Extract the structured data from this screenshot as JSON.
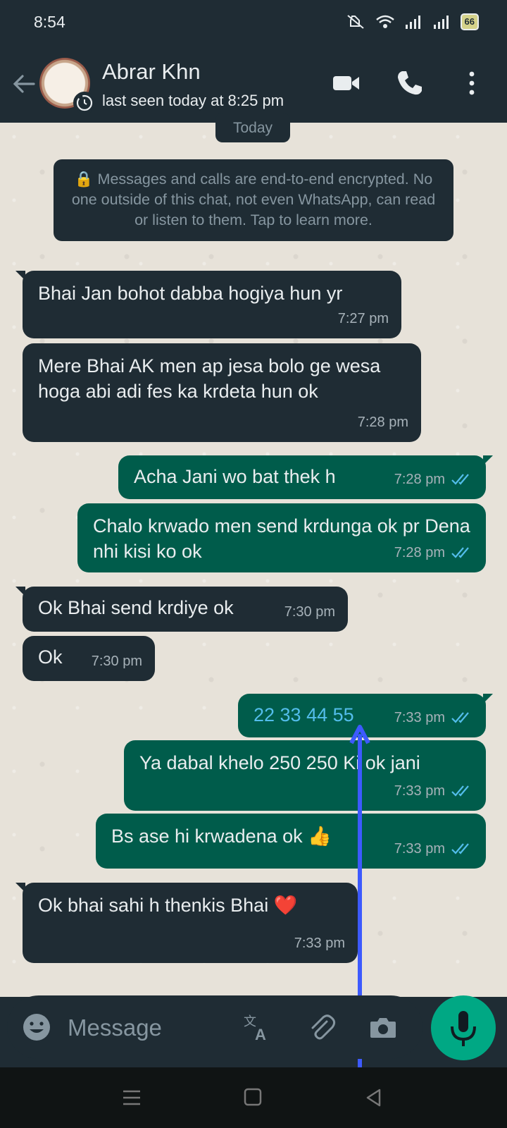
{
  "status_bar": {
    "time": "8:54",
    "battery": "66",
    "icons": [
      "mute-icon",
      "wifi-icon",
      "signal-icon",
      "signal-icon"
    ]
  },
  "header": {
    "contact_name": "Abrar Khn",
    "last_seen": "last seen today at 8:25 pm",
    "actions": [
      "video-call-icon",
      "call-icon",
      "more-icon"
    ]
  },
  "chat": {
    "date_chip": "Today",
    "encryption_notice": "🔒 Messages and calls are end-to-end encrypted. No one outside of this chat, not even WhatsApp, can read or listen to them. Tap to learn more.",
    "messages": [
      {
        "direction": "incoming",
        "text": "Bhai Jan bohot dabba hogiya hun yr",
        "time": "7:27 pm"
      },
      {
        "direction": "incoming",
        "text": "Mere Bhai AK men ap jesa bolo ge wesa hoga abi adi fes ka krdeta hun ok",
        "time": "7:28 pm"
      },
      {
        "direction": "outgoing",
        "text": "Acha Jani wo bat thek h",
        "time": "7:28 pm",
        "status": "read"
      },
      {
        "direction": "outgoing",
        "text": "Chalo krwado men send krdunga ok pr Dena nhi kisi ko ok",
        "time": "7:28 pm",
        "status": "read"
      },
      {
        "direction": "incoming",
        "text": "Ok Bhai send krdiye ok",
        "time": "7:30 pm"
      },
      {
        "direction": "incoming",
        "text": "Ok",
        "time": "7:30 pm"
      },
      {
        "direction": "outgoing",
        "text": "22 33 44 55",
        "time": "7:33 pm",
        "status": "read"
      },
      {
        "direction": "outgoing",
        "text": "Ya dabal khelo 250 250 Ki ok jani",
        "time": "7:33 pm",
        "status": "read"
      },
      {
        "direction": "outgoing",
        "text": "Bs ase hi krwadena ok 👍",
        "time": "7:33 pm",
        "status": "read"
      },
      {
        "direction": "incoming",
        "text": "Ok bhai sahi h thenkis Bhai ❤️",
        "time": "7:33 pm"
      }
    ]
  },
  "composer": {
    "placeholder": "Message",
    "tools": [
      "translate-icon",
      "attach-icon",
      "camera-icon"
    ]
  },
  "colors": {
    "header_bg": "#1f2c34",
    "incoming_bubble": "#1f2c34",
    "outgoing_bubble": "#005c4b",
    "accent": "#00a884",
    "read_tick": "#53bdeb",
    "annotation_arrow": "#3d5afe"
  }
}
